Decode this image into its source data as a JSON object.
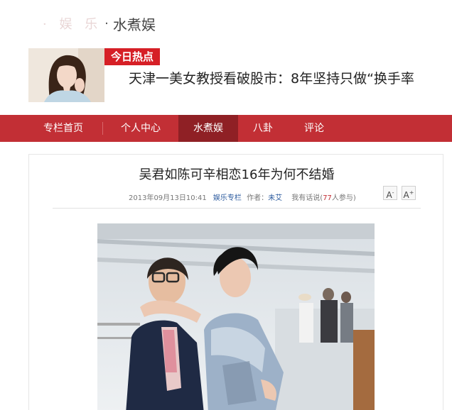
{
  "header": {
    "logo_faded": "· 娱 乐",
    "logo_name": "水煮娱",
    "logo_dot": "·"
  },
  "hot": {
    "badge": "今日热点",
    "headline": "天津一美女教授看破股市：8年坚持只做“换手率"
  },
  "nav": {
    "items": [
      {
        "label": "专栏首页"
      },
      {
        "label": "个人中心"
      },
      {
        "label": "水煮娱"
      },
      {
        "label": "八卦"
      },
      {
        "label": "评论"
      }
    ],
    "active": "水煮娱"
  },
  "article": {
    "title": "吴君如陈可辛相恋16年为何不结婚",
    "date": "2013年09月13日10:41",
    "column": "娱乐专栏",
    "author_label": "作者：",
    "author": "未艾",
    "comment_prefix": "我有话说(",
    "comment_count": "77",
    "comment_suffix": "人参与)",
    "font_decrease": "A",
    "font_increase": "A",
    "font_decrease_sup": "-",
    "font_increase_sup": "+"
  },
  "colors": {
    "brand_red": "#c22f35",
    "badge_red": "#d61f26",
    "nav_active": "#8f2025",
    "link_blue": "#2b5a9e"
  },
  "icons": {
    "font_decrease": "font-size-decrease-icon",
    "font_increase": "font-size-increase-icon"
  }
}
